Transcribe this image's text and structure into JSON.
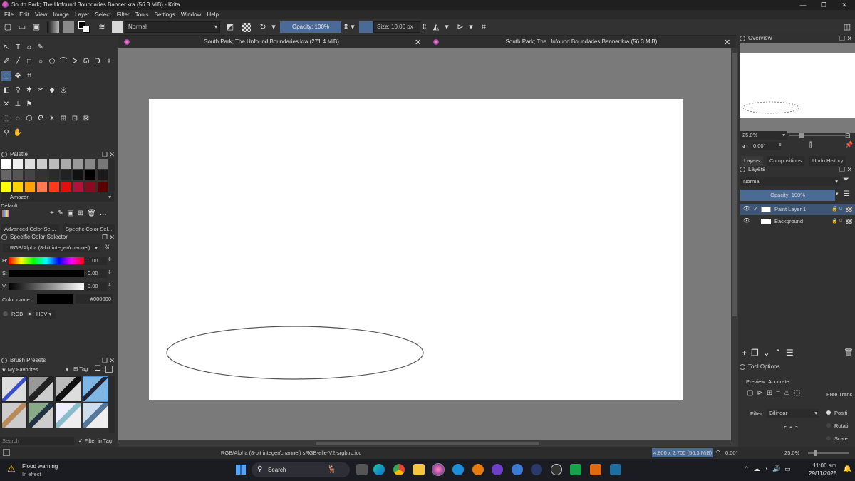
{
  "window": {
    "title": "South Park; The Unfound Boundaries Banner.kra (56.3 MiB)  - Krita",
    "controls": [
      "—",
      "❐",
      "✕"
    ]
  },
  "menu": [
    "File",
    "Edit",
    "View",
    "Image",
    "Layer",
    "Select",
    "Filter",
    "Tools",
    "Settings",
    "Window",
    "Help"
  ],
  "toolbar": {
    "blend_mode": "Normal",
    "opacity": "Opacity: 100%",
    "size": "Size: 10.00 px"
  },
  "view_tabs": [
    {
      "label": "South Park; The Unfound Boundaries.kra (271.4 MiB)"
    },
    {
      "label": "South Park; The Unfound Boundaries Banner.kra (56.3 MiB)"
    }
  ],
  "palette": {
    "title": "Palette",
    "set_name": "Amazon",
    "group": "Default",
    "colors_row1": [
      "#ffffff",
      "#eeeeee",
      "#dddddd",
      "#cccccc",
      "#bbbbbb",
      "#aaaaaa",
      "#999999",
      "#888888",
      "#777777"
    ],
    "colors_row2": [
      "#666666",
      "#555555",
      "#444444",
      "#333333",
      "#2b2b2b",
      "#222222",
      "#111111",
      "#000000",
      "#1a1a1a"
    ],
    "colors_row3": [
      "#ffff00",
      "#ffd200",
      "#ffa200",
      "#ff7a50",
      "#ff3a1a",
      "#e01010",
      "#b0123a",
      "#8a0a1e",
      "#5a0000"
    ]
  },
  "color_selector": {
    "tabs": [
      "Advanced Color Sel...",
      "Specific Color Sel..."
    ],
    "title": "Specific Color Selector",
    "model": "RGB/Alpha (8-bit integer/channel)",
    "percent": "%",
    "channels": [
      {
        "label": "H:",
        "value": "0.00"
      },
      {
        "label": "S:",
        "value": "0.00"
      },
      {
        "label": "V:",
        "value": "0.00"
      }
    ],
    "color_name_label": "Color name:",
    "hex": "#000000",
    "radio_rgb": "RGB",
    "radio_hsv": "HSV"
  },
  "brush_presets": {
    "title": "Brush Presets",
    "favorites": "★ My Favorites",
    "tag": "Tag",
    "search_placeholder": "Search",
    "filter_in_tag": "Filter in Tag"
  },
  "overview": {
    "title": "Overview",
    "zoom": "25.0%",
    "rotation": "0.00°"
  },
  "layers": {
    "tabs": [
      "Layers",
      "Compositions",
      "Undo History"
    ],
    "title": "Layers",
    "blend_mode": "Normal",
    "opacity": "Opacity:  100%",
    "items": [
      {
        "name": "Paint Layer 1",
        "selected": true
      },
      {
        "name": "Background",
        "selected": false
      }
    ]
  },
  "tool_options": {
    "title": "Tool Options",
    "preview_label": "Preview",
    "preview_value": "Accurate",
    "free_transform": "Free Trans",
    "filter_label": "Filter:",
    "filter_value": "Bilinear",
    "radio1": "Positi",
    "radio2": "Rotati",
    "radio3": "Scale"
  },
  "status": {
    "color_profile": "RGB/Alpha (8-bit integer/channel)  sRGB-elle-V2-srgbtrc.icc",
    "dimensions": "4,800 x 2,700 (56.3 MiB)",
    "rotation": "0.00°",
    "zoom": "25.0%"
  },
  "taskbar": {
    "notification_title": "Flood warning",
    "notification_sub": "In effect",
    "search": "Search",
    "time": "11:06 am",
    "date": "29/11/2025"
  }
}
